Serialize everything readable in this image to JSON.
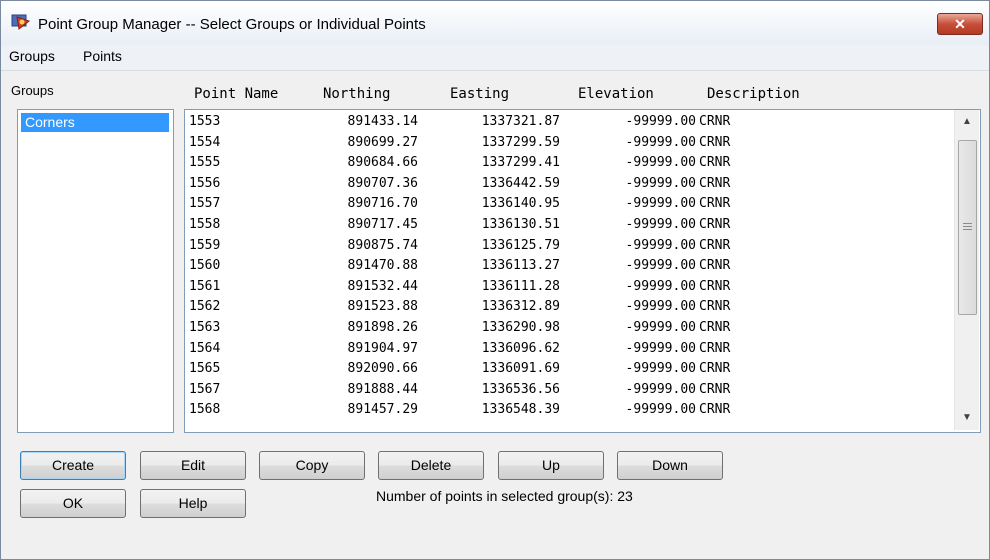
{
  "window": {
    "title": "Point Group Manager -- Select Groups or Individual Points",
    "close_label": "✕"
  },
  "menu": [
    "Groups",
    "Points"
  ],
  "groups": {
    "label": "Groups",
    "items": [
      "Corners"
    ],
    "selected": "Corners"
  },
  "columns": [
    "Point Name",
    "Northing",
    "Easting",
    "Elevation",
    "Description"
  ],
  "points": [
    {
      "name": "1553",
      "northing": "891433.14",
      "easting": "1337321.87",
      "elevation": "-99999.00",
      "description": "CRNR"
    },
    {
      "name": "1554",
      "northing": "890699.27",
      "easting": "1337299.59",
      "elevation": "-99999.00",
      "description": "CRNR"
    },
    {
      "name": "1555",
      "northing": "890684.66",
      "easting": "1337299.41",
      "elevation": "-99999.00",
      "description": "CRNR"
    },
    {
      "name": "1556",
      "northing": "890707.36",
      "easting": "1336442.59",
      "elevation": "-99999.00",
      "description": "CRNR"
    },
    {
      "name": "1557",
      "northing": "890716.70",
      "easting": "1336140.95",
      "elevation": "-99999.00",
      "description": "CRNR"
    },
    {
      "name": "1558",
      "northing": "890717.45",
      "easting": "1336130.51",
      "elevation": "-99999.00",
      "description": "CRNR"
    },
    {
      "name": "1559",
      "northing": "890875.74",
      "easting": "1336125.79",
      "elevation": "-99999.00",
      "description": "CRNR"
    },
    {
      "name": "1560",
      "northing": "891470.88",
      "easting": "1336113.27",
      "elevation": "-99999.00",
      "description": "CRNR"
    },
    {
      "name": "1561",
      "northing": "891532.44",
      "easting": "1336111.28",
      "elevation": "-99999.00",
      "description": "CRNR"
    },
    {
      "name": "1562",
      "northing": "891523.88",
      "easting": "1336312.89",
      "elevation": "-99999.00",
      "description": "CRNR"
    },
    {
      "name": "1563",
      "northing": "891898.26",
      "easting": "1336290.98",
      "elevation": "-99999.00",
      "description": "CRNR"
    },
    {
      "name": "1564",
      "northing": "891904.97",
      "easting": "1336096.62",
      "elevation": "-99999.00",
      "description": "CRNR"
    },
    {
      "name": "1565",
      "northing": "892090.66",
      "easting": "1336091.69",
      "elevation": "-99999.00",
      "description": "CRNR"
    },
    {
      "name": "1567",
      "northing": "891888.44",
      "easting": "1336536.56",
      "elevation": "-99999.00",
      "description": "CRNR"
    },
    {
      "name": "1568",
      "northing": "891457.29",
      "easting": "1336548.39",
      "elevation": "-99999.00",
      "description": "CRNR"
    }
  ],
  "buttons": {
    "create": "Create",
    "edit": "Edit",
    "copy": "Copy",
    "delete": "Delete",
    "up": "Up",
    "down": "Down",
    "ok": "OK",
    "help": "Help"
  },
  "status": {
    "label": "Number of points in selected group(s):",
    "count": "23"
  },
  "scrollbar": {
    "up_icon": "▲",
    "down_icon": "▼"
  }
}
